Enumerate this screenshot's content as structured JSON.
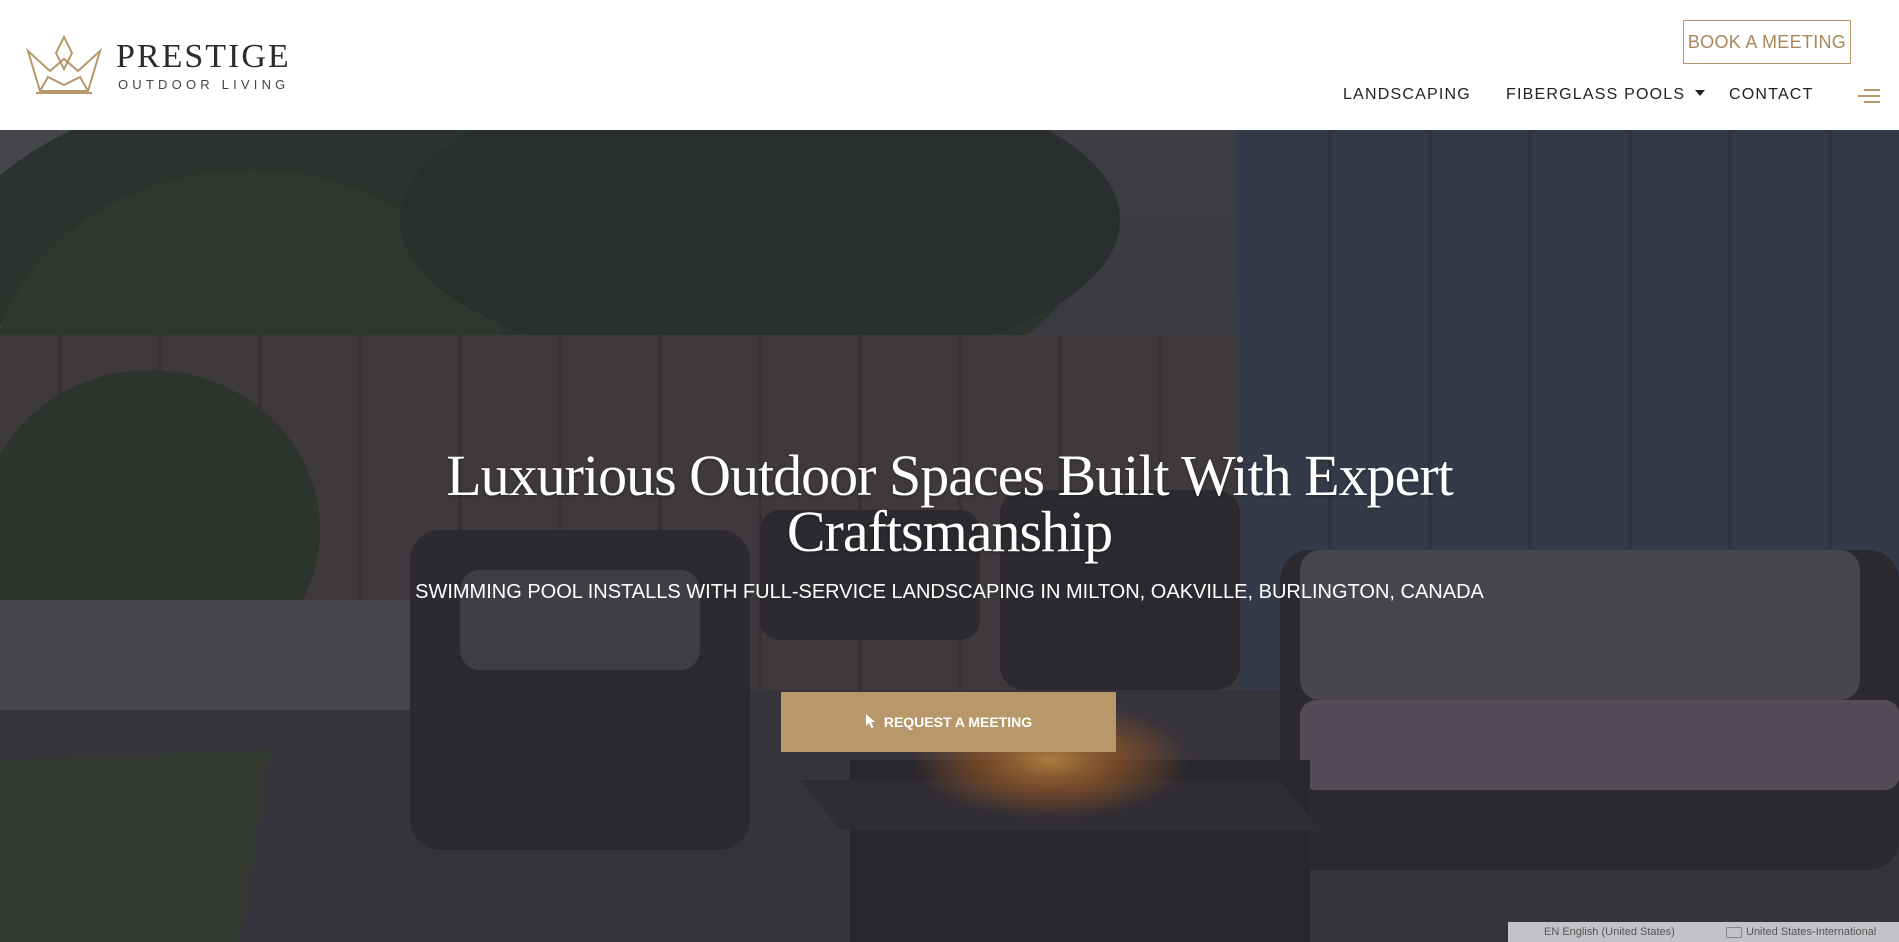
{
  "brand": {
    "name": "PRESTIGE",
    "tagline": "OUTDOOR LIVING",
    "accent_color": "#b8976a"
  },
  "header": {
    "book_button": "BOOK A MEETING",
    "nav": [
      {
        "label": "LANDSCAPING"
      },
      {
        "label": "FIBERGLASS POOLS"
      },
      {
        "label": "CONTACT"
      }
    ],
    "menu_icon": "hamburger-menu-icon"
  },
  "hero": {
    "title_line1": "Luxurious Outdoor Spaces Built With Expert",
    "title_line2": "Craftsmanship",
    "subtitle": "SWIMMING POOL INSTALLS WITH FULL-SERVICE LANDSCAPING IN MILTON, OAKVILLE, BURLINGTON, CANADA",
    "cta_label": "REQUEST A MEETING",
    "cta_icon": "cursor-pointer-icon"
  },
  "os_bar": {
    "language": "EN English (United States)",
    "keyboard": "United States-International"
  }
}
